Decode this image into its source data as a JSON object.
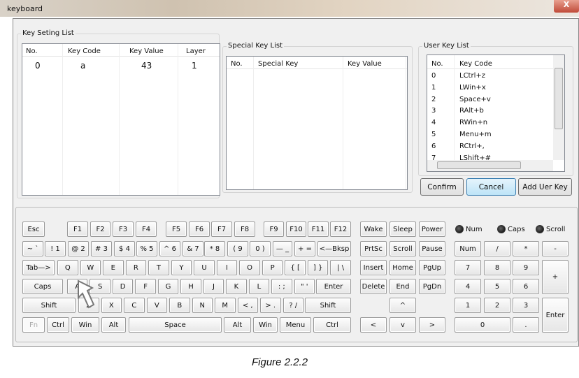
{
  "window": {
    "title": "keyboard",
    "close": "X"
  },
  "key_setting": {
    "label": "Key Seting List",
    "headers": [
      "No.",
      "Key Code",
      "Key Value",
      "Layer"
    ],
    "rows": [
      [
        "0",
        "a",
        "43",
        "1"
      ]
    ]
  },
  "special_key": {
    "label": "Special Key List",
    "headers": [
      "No.",
      "Special Key",
      "Key Value"
    ]
  },
  "user_key": {
    "label": "User Key List",
    "headers": [
      "No.",
      "Key Code"
    ],
    "rows": [
      [
        "0",
        "LCtrl+z"
      ],
      [
        "1",
        "LWin+x"
      ],
      [
        "2",
        "Space+v"
      ],
      [
        "3",
        "RAlt+b"
      ],
      [
        "4",
        "RWin+n"
      ],
      [
        "5",
        "Menu+m"
      ],
      [
        "6",
        "RCtrl+,"
      ],
      [
        "7",
        "LShift+#"
      ]
    ]
  },
  "buttons": {
    "confirm": "Confirm",
    "cancel": "Cancel",
    "add": "Add Uer Key"
  },
  "indicators": [
    "Num",
    "Caps",
    "Scroll"
  ],
  "keyboard": {
    "row1": [
      "Esc",
      "F1",
      "F2",
      "F3",
      "F4",
      "F5",
      "F6",
      "F7",
      "F8",
      "F9",
      "F10",
      "F11",
      "F12"
    ],
    "row2": [
      "~ `",
      "! 1",
      "@ 2",
      "# 3",
      "$ 4",
      "% 5",
      "^ 6",
      "& 7",
      "* 8",
      "( 9",
      "0 )",
      "— _",
      "+ =",
      "<—Bksp"
    ],
    "row3": [
      "Tab—>",
      "Q",
      "W",
      "E",
      "R",
      "T",
      "Y",
      "U",
      "I",
      "O",
      "P",
      "{ [",
      "] }",
      "| \\"
    ],
    "row4": [
      "Caps",
      "A",
      "S",
      "D",
      "F",
      "G",
      "H",
      "J",
      "K",
      "L",
      ": ;",
      "\" '",
      "Enter"
    ],
    "row5": [
      "Shift",
      "Z",
      "X",
      "C",
      "V",
      "B",
      "N",
      "M",
      "< ,",
      "> .",
      "? /",
      "Shift"
    ],
    "row6": [
      "Fn",
      "Ctrl",
      "Win",
      "Alt",
      "Space",
      "Alt",
      "Win",
      "Menu",
      "Ctrl"
    ],
    "nav": [
      "Wake",
      "Sleep",
      "Power",
      "PrtSc",
      "Scroll",
      "Pause",
      "Insert",
      "Home",
      "PgUp",
      "Delete",
      "End",
      "PgDn",
      "^",
      "<",
      "v",
      ">"
    ],
    "numpad": [
      "Num",
      "/",
      "*",
      "-",
      "7",
      "8",
      "9",
      "+",
      "4",
      "5",
      "6",
      "1",
      "2",
      "3",
      "Enter",
      "0",
      "."
    ]
  },
  "caption": "Figure 2.2.2"
}
